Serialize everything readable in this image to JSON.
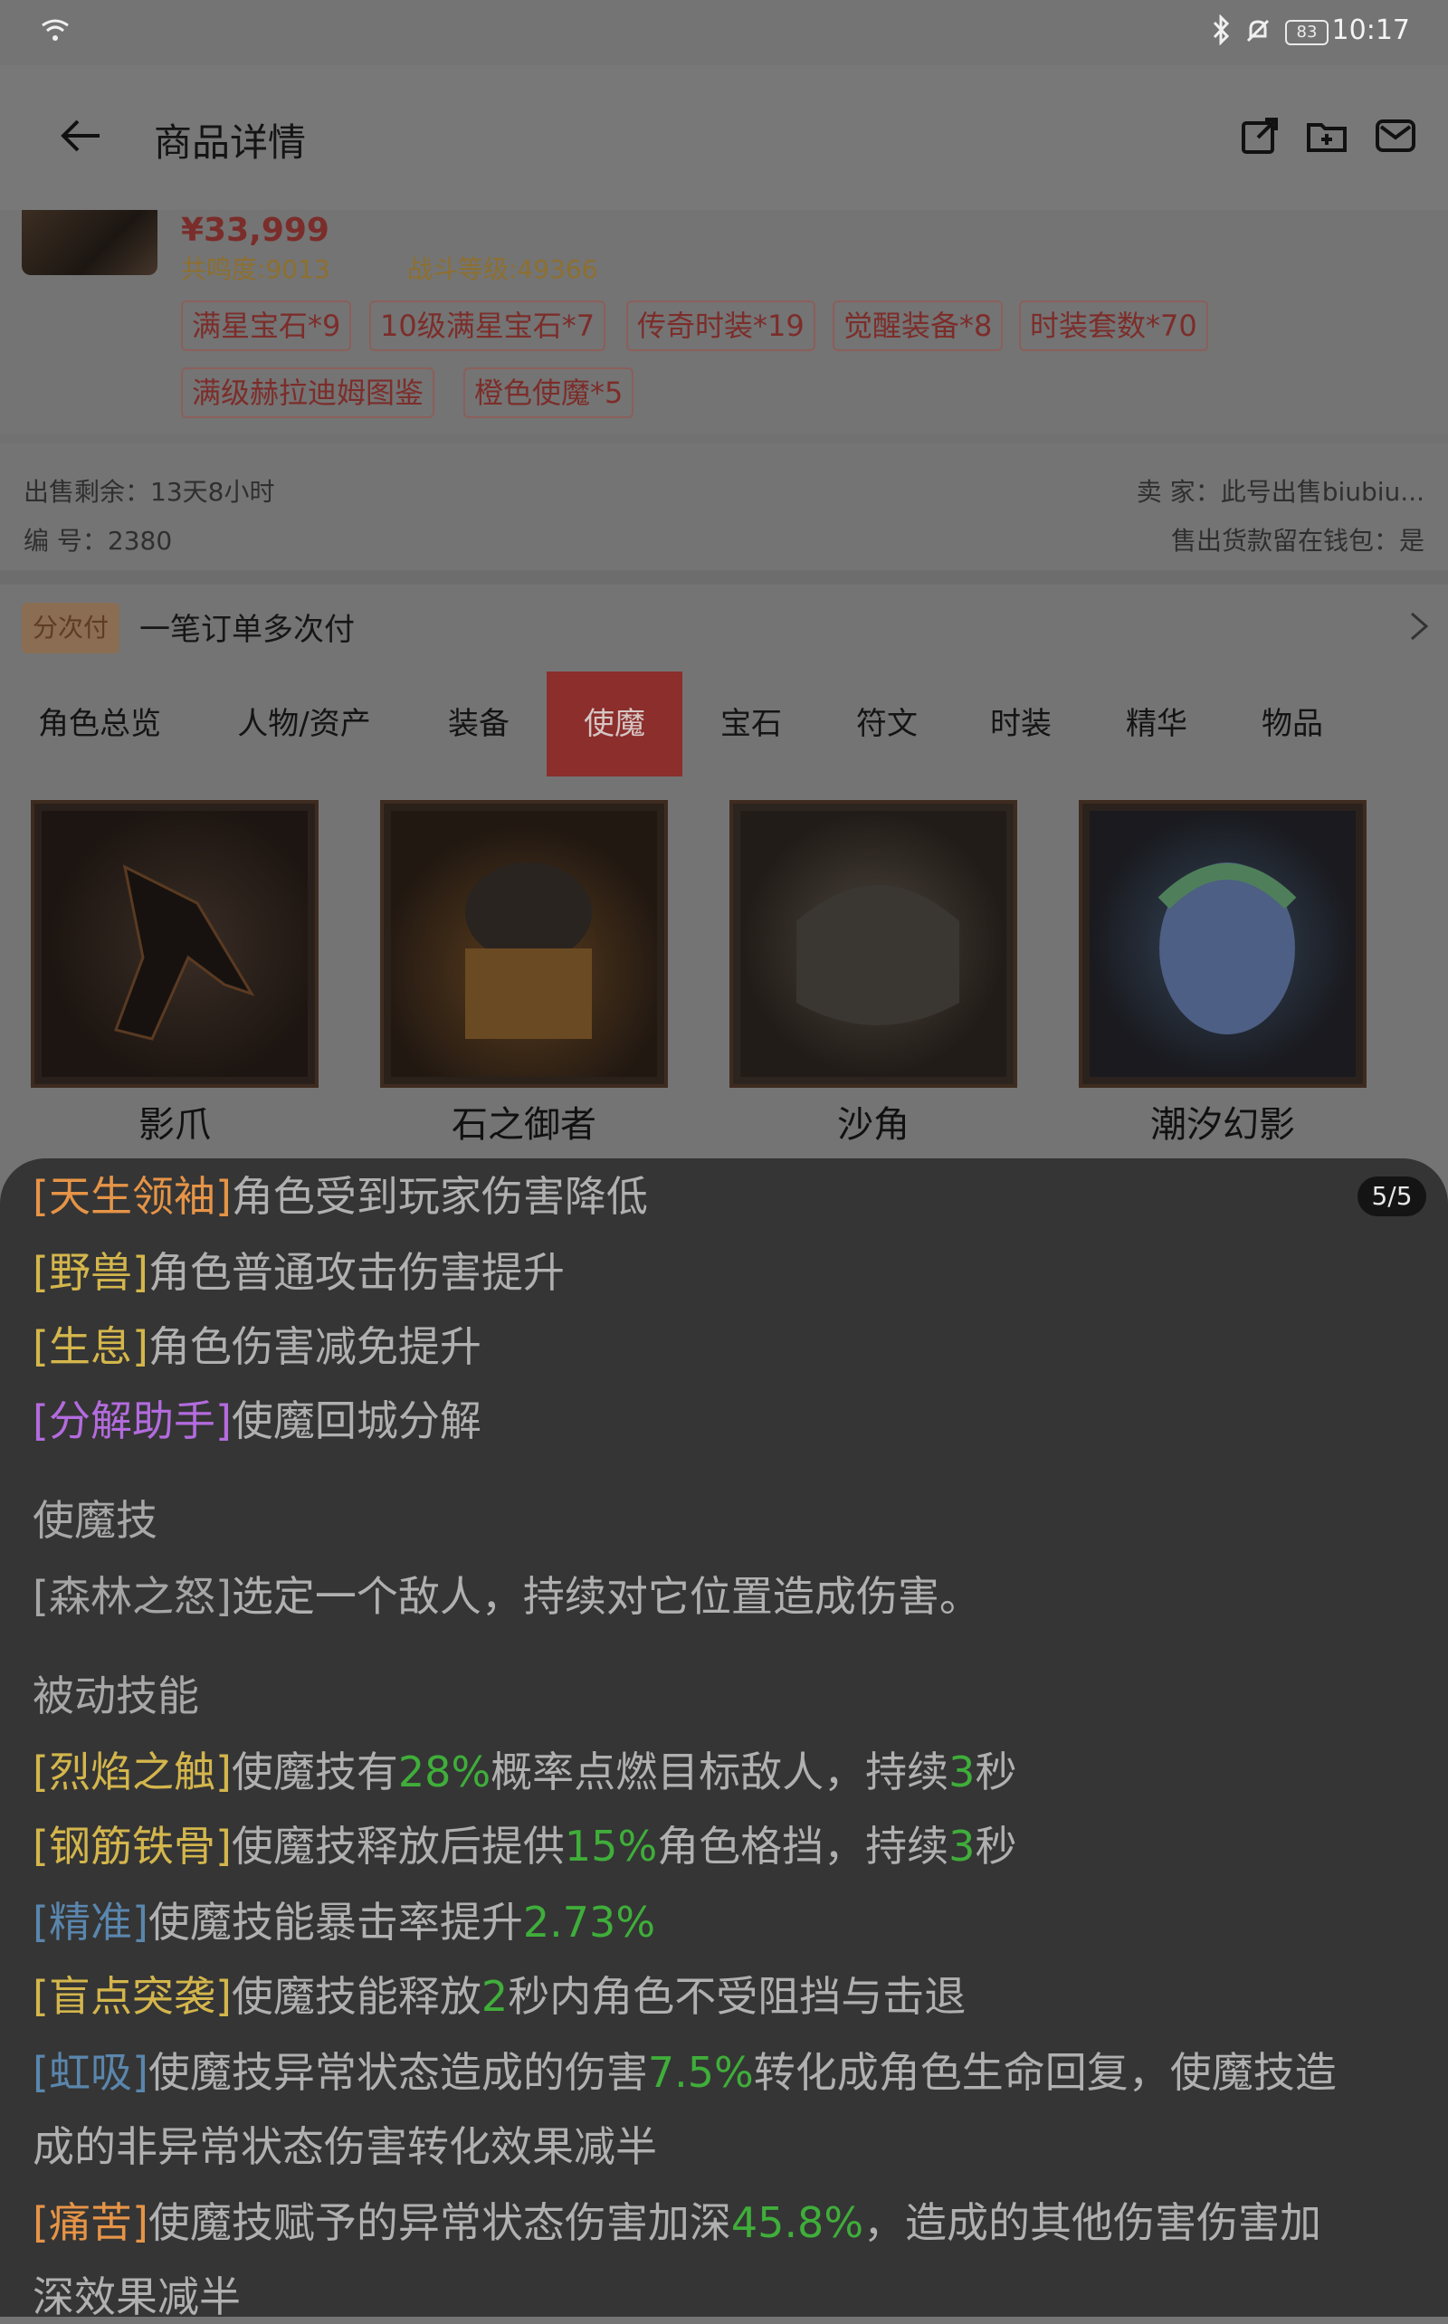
{
  "status_bar": {
    "battery": "83",
    "time": "10:17"
  },
  "app_bar": {
    "title": "商品详情"
  },
  "product": {
    "price": "¥33,999",
    "resonance": "共鸣度:9013",
    "combat_level": "战斗等级:49366",
    "tags": [
      "满星宝石*9",
      "10级满星宝石*7",
      "传奇时装*19",
      "觉醒装备*8",
      "时装套数*70",
      "满级赫拉迪姆图鉴",
      "橙色使魔*5"
    ],
    "remaining_label": "出售剩余：13天8小时",
    "seller_label": "卖  家：此号出售biubiu...",
    "id_label": "编  号：2380",
    "wallet_label": "售出货款留在钱包：是"
  },
  "installment": {
    "badge": "分次付",
    "text": "一笔订单多次付"
  },
  "tabs": [
    "角色总览",
    "人物/资产",
    "装备",
    "使魔",
    "宝石",
    "符文",
    "时装",
    "精华",
    "物品"
  ],
  "familiars": [
    "影爪",
    "石之御者",
    "沙角",
    "潮汐幻影"
  ],
  "sheet": {
    "pager": "5/5",
    "traits": [
      {
        "name": "[天生领袖]",
        "desc": "角色受到玩家伤害降低"
      },
      {
        "name": "[野兽]",
        "desc": "角色普通攻击伤害提升"
      },
      {
        "name": "[生息]",
        "desc": "角色伤害减免提升"
      },
      {
        "name": "[分解助手]",
        "desc": "使魔回城分解"
      }
    ],
    "skill_heading": "使魔技",
    "skill": {
      "name": "[森林之怒]",
      "desc": "选定一个敌人，持续对它位置造成伤害。"
    },
    "passive_heading": "被动技能",
    "passives": {
      "p1": {
        "name": "[烈焰之触]",
        "a": "使魔技有",
        "v1": "28%",
        "b": "概率点燃目标敌人，持续",
        "v2": "3",
        "c": "秒"
      },
      "p2": {
        "name": "[钢筋铁骨]",
        "a": "使魔技释放后提供",
        "v1": "15%",
        "b": "角色格挡，持续",
        "v2": "3",
        "c": "秒"
      },
      "p3": {
        "name": "[精准]",
        "a": "使魔技能暴击率提升",
        "v1": "2.73%"
      },
      "p4": {
        "name": "[盲点突袭]",
        "a": "使魔技能释放",
        "v1": "2",
        "b": "秒内角色不受阻挡与击退"
      },
      "p5": {
        "name": "[虹吸]",
        "a": "使魔技异常状态造成的伤害",
        "v1": "7.5%",
        "b": "转化成角色生命回复，使魔技造",
        "c": "成的非异常状态伤害转化效果减半"
      },
      "p6": {
        "name": "[痛苦]",
        "a": "使魔技赋予的异常状态伤害加深",
        "v1": "45.8%",
        "b": "，造成的其他伤害伤害加",
        "c": "深效果减半"
      }
    }
  },
  "colors": {
    "accent_tab": "#8b2e2c",
    "sheet_bg": "#353535",
    "value_green": "#3fae3a"
  }
}
